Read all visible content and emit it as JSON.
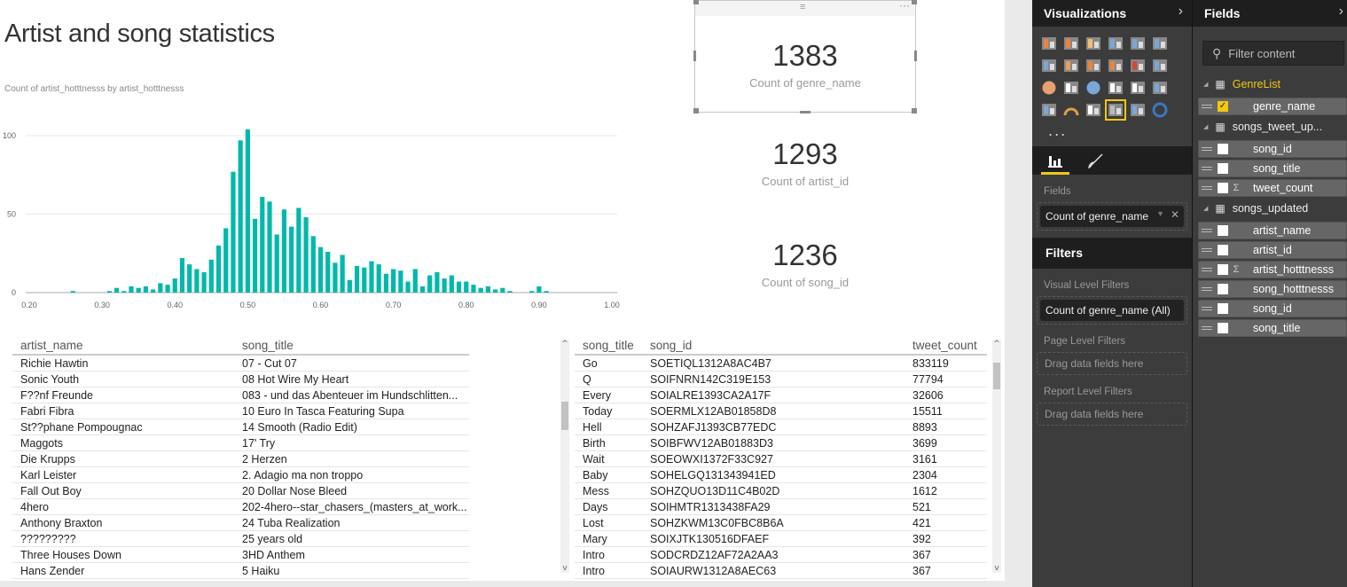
{
  "page": {
    "title": "Artist and song statistics",
    "chart_subtitle": "Count of  artist_hotttnesss  by  artist_hotttnesss"
  },
  "cards": [
    {
      "value": "1383",
      "label": "Count of genre_name"
    },
    {
      "value": "1293",
      "label": "Count of artist_id"
    },
    {
      "value": "1236",
      "label": "Count of song_id"
    }
  ],
  "chart_data": {
    "type": "bar",
    "title": "Count of artist_hotttnesss by artist_hotttnesss",
    "xlabel": "",
    "ylabel": "",
    "x": [
      0.26,
      0.27,
      0.28,
      0.29,
      0.3,
      0.31,
      0.32,
      0.33,
      0.34,
      0.35,
      0.36,
      0.37,
      0.38,
      0.39,
      0.4,
      0.41,
      0.42,
      0.43,
      0.44,
      0.45,
      0.46,
      0.47,
      0.48,
      0.49,
      0.5,
      0.51,
      0.52,
      0.53,
      0.54,
      0.55,
      0.56,
      0.57,
      0.58,
      0.59,
      0.6,
      0.61,
      0.62,
      0.63,
      0.64,
      0.65,
      0.66,
      0.67,
      0.68,
      0.69,
      0.7,
      0.71,
      0.72,
      0.73,
      0.74,
      0.75,
      0.76,
      0.77,
      0.78,
      0.79,
      0.8,
      0.81,
      0.82,
      0.83,
      0.84,
      0.85,
      0.86,
      0.87,
      0.88,
      0.89,
      0.9,
      0.91
    ],
    "values": [
      1,
      0,
      0,
      0,
      0,
      1,
      3,
      1,
      4,
      3,
      4,
      2,
      6,
      5,
      9,
      22,
      18,
      15,
      13,
      21,
      30,
      41,
      77,
      97,
      104,
      47,
      61,
      58,
      37,
      53,
      42,
      54,
      48,
      36,
      29,
      26,
      19,
      24,
      8,
      17,
      16,
      20,
      18,
      12,
      15,
      14,
      7,
      15,
      4,
      11,
      13,
      9,
      11,
      7,
      7,
      5,
      3,
      4,
      2,
      3,
      1,
      0,
      0,
      1,
      4,
      1
    ],
    "xlim": [
      0.2,
      1.0
    ],
    "ylim": [
      0,
      100
    ],
    "x_ticks": [
      "0.20",
      "0.30",
      "0.40",
      "0.50",
      "0.60",
      "0.70",
      "0.80",
      "0.90",
      "1.00"
    ],
    "y_ticks": [
      "0",
      "50",
      "100"
    ],
    "color": "#01b8aa",
    "grid": true
  },
  "left_table": {
    "columns": [
      "artist_name",
      "song_title"
    ],
    "rows": [
      [
        "Richie Hawtin",
        "07 - Cut 07"
      ],
      [
        "Sonic Youth",
        "08 Hot Wire My Heart"
      ],
      [
        "F??nf Freunde",
        "083 - und das Abenteuer im Hundschlitten..."
      ],
      [
        "Fabri Fibra",
        "10 Euro In Tasca Featuring Supa"
      ],
      [
        "St??phane Pompougnac",
        "14 Smooth (Radio Edit)"
      ],
      [
        "Maggots",
        "17' Try"
      ],
      [
        "Die Krupps",
        "2 Herzen"
      ],
      [
        "Karl Leister",
        "2. Adagio ma non troppo"
      ],
      [
        "Fall Out Boy",
        "20 Dollar Nose Bleed"
      ],
      [
        "4hero",
        "202-4hero--star_chasers_(masters_at_work..."
      ],
      [
        "Anthony Braxton",
        "24 Tuba Realization"
      ],
      [
        "?????????",
        "25 years old"
      ],
      [
        "Three Houses Down",
        "3HD Anthem"
      ],
      [
        "Hans Zender",
        "5 Haiku"
      ]
    ]
  },
  "right_table": {
    "columns": [
      "song_title",
      "song_id",
      "tweet_count"
    ],
    "rows": [
      [
        "Go",
        "SOETIQL1312A8AC4B7",
        "833119"
      ],
      [
        "Q",
        "SOIFNRN142C319E153",
        "77794"
      ],
      [
        "Every",
        "SOIALRE1393CA2A17F",
        "32606"
      ],
      [
        "Today",
        "SOERMLX12AB01858D8",
        "15511"
      ],
      [
        "Hell",
        "SOHZAFJ1393CB77EDC",
        "8893"
      ],
      [
        "Birth",
        "SOIBFWV12AB01883D3",
        "3699"
      ],
      [
        "Wait",
        "SOEOWXI1372F33C927",
        "3161"
      ],
      [
        "Baby",
        "SOHELGQ131343941ED",
        "2304"
      ],
      [
        "Mess",
        "SOHZQUO13D11C4B02D",
        "1612"
      ],
      [
        "Days",
        "SOIHMTR1313438FA29",
        "521"
      ],
      [
        "Lost",
        "SOHZKWM13C0FBC8B6A",
        "421"
      ],
      [
        "Mary",
        "SOIXJTK130516DFAEF",
        "392"
      ],
      [
        "Intro",
        "SODCRDZ12AF72A2AA3",
        "367"
      ],
      [
        "Intro",
        "SOIAURW1312A8AEC63",
        "367"
      ]
    ]
  },
  "visualizations": {
    "title": "Visualizations",
    "more": "...",
    "fields_label": "Fields",
    "field_pill": "Count of genre_name"
  },
  "filters": {
    "title": "Filters",
    "visual_level": "Visual Level Filters",
    "visual_pill": "Count of genre_name (All)",
    "page_level": "Page Level Filters",
    "report_level": "Report Level Filters",
    "drag_hint": "Drag data fields here"
  },
  "fields": {
    "title": "Fields",
    "search_placeholder": "Filter content",
    "tables": [
      {
        "name": "GenreList",
        "items": [
          {
            "name": "genre_name",
            "checked": true,
            "sigma": false
          }
        ]
      },
      {
        "name": "songs_tweet_up...",
        "items": [
          {
            "name": "song_id",
            "sigma": false
          },
          {
            "name": "song_title",
            "sigma": false
          },
          {
            "name": "tweet_count",
            "sigma": true
          }
        ]
      },
      {
        "name": "songs_updated",
        "items": [
          {
            "name": "artist_name",
            "sigma": false
          },
          {
            "name": "artist_id",
            "sigma": false
          },
          {
            "name": "artist_hotttnesss",
            "sigma": true
          },
          {
            "name": "song_hotttnesss",
            "sigma": false
          },
          {
            "name": "song_id",
            "sigma": false
          },
          {
            "name": "song_title",
            "sigma": false
          }
        ]
      }
    ]
  },
  "colors": {
    "accent": "#f2c811",
    "bar": "#01b8aa"
  }
}
